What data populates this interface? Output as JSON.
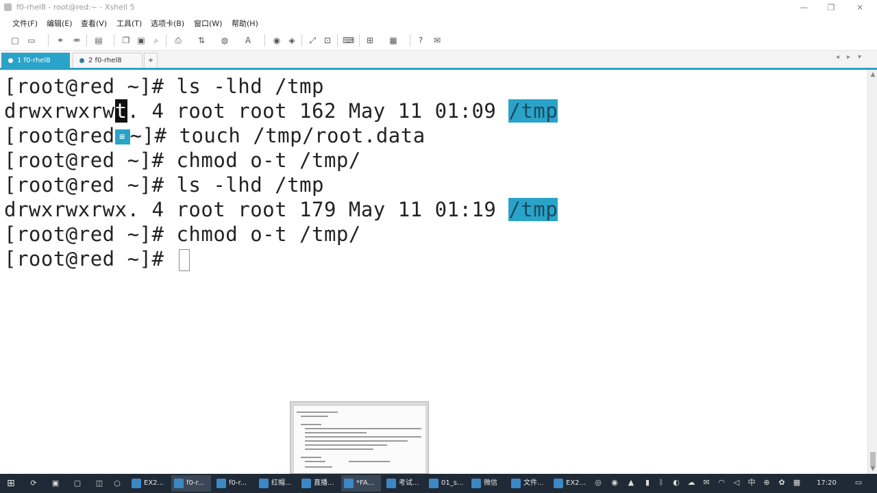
{
  "window": {
    "title": "f0-rhel8 - root@red:~ - Xshell 5",
    "minimize_glyph": "—",
    "restore_glyph": "❐",
    "close_glyph": "✕"
  },
  "menu": [
    "文件(F)",
    "编辑(E)",
    "查看(V)",
    "工具(T)",
    "选项卡(B)",
    "窗口(W)",
    "帮助(H)"
  ],
  "tabs": [
    {
      "label": "1 f0-rhel8",
      "active": true
    },
    {
      "label": "2 f0-rhel8",
      "active": false
    }
  ],
  "tab_add": "+",
  "tab_nav_prev": "◂",
  "tab_nav_next": "▸",
  "tab_nav_menu": "▾",
  "terminal": {
    "lines": [
      {
        "prompt": "[root@red ~]# ",
        "text": "ls -lhd /tmp"
      },
      {
        "pre": "drwxrwxrw",
        "cursor_char": "t",
        "post": ". 4 root root 162 May 11 01:09 ",
        "path": "/tmp"
      },
      {
        "prompt_a": "[root@red",
        "note": "≡",
        "prompt_b": "~]# ",
        "text": "touch /tmp/root.data"
      },
      {
        "prompt": "[root@red ~]# ",
        "text": "chmod o-t /tmp/"
      },
      {
        "prompt": "[root@red ~]# ",
        "text": "ls -lhd /tmp"
      },
      {
        "pre": "drwxrwxrwx. 4 root root 179 May 11 01:19 ",
        "path": "/tmp"
      },
      {
        "prompt": "[root@red ~]# ",
        "text": "chmod o-t /tmp/"
      },
      {
        "prompt": "[root@red ~]# ",
        "text": ""
      }
    ]
  },
  "taskbar": {
    "start_glyph": "⊞",
    "items": [
      "EX2...",
      "f0-r...",
      "f0-r...",
      "红帽...",
      "直播...",
      "*FA...",
      "考试...",
      "01_s...",
      "微信",
      "文件...",
      "EX2..."
    ],
    "clock": "17:20"
  },
  "colors": {
    "accent": "#2aa3c9",
    "taskbar": "#1f2a36"
  }
}
